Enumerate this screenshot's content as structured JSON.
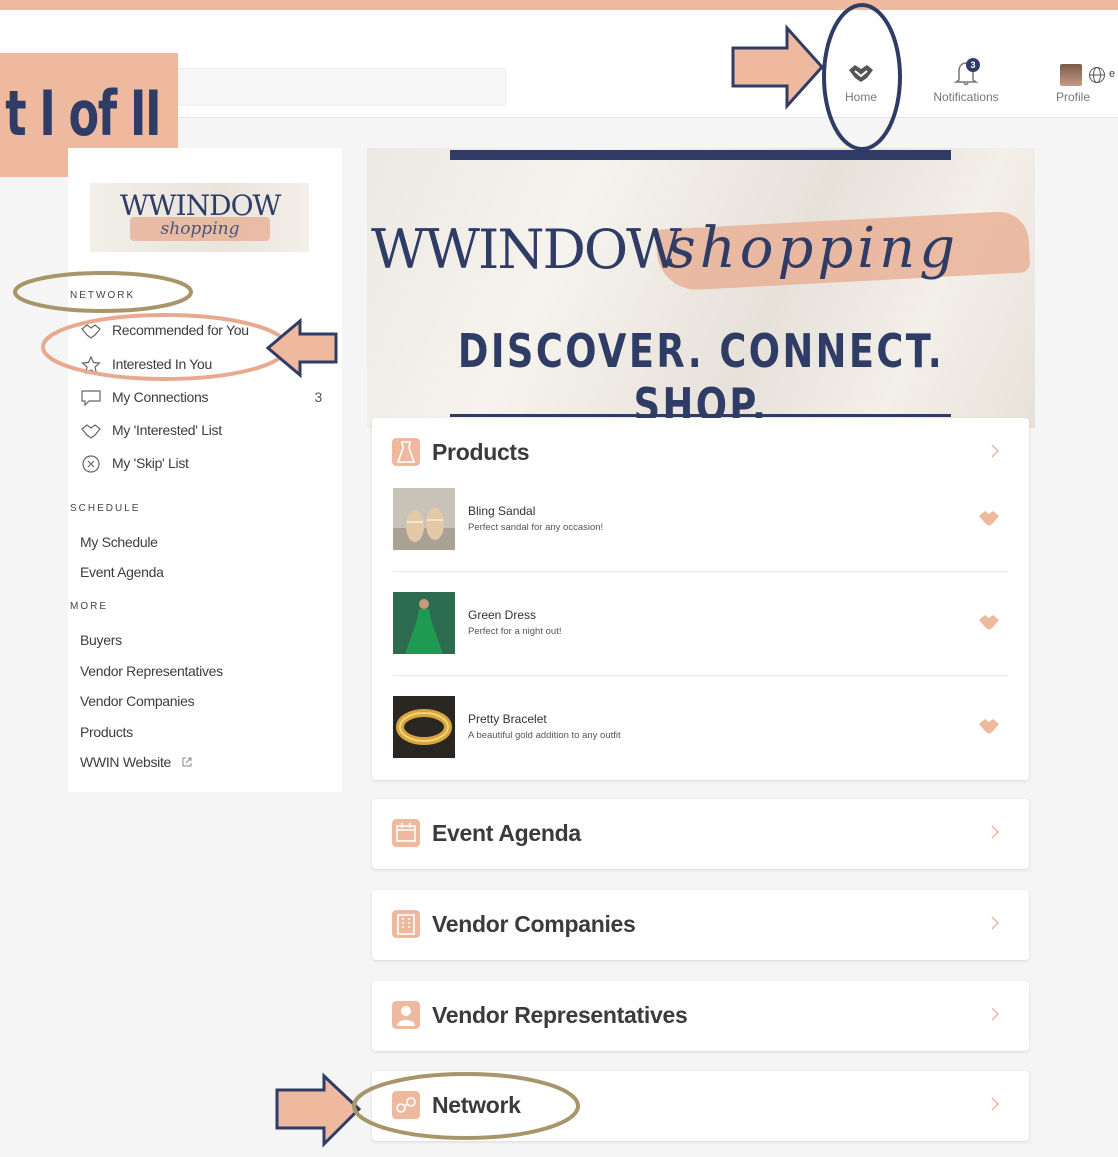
{
  "banner": {
    "title": "t I of II"
  },
  "header": {
    "nav": [
      {
        "label": "Home",
        "icon": "handshake-icon"
      },
      {
        "label": "Notifications",
        "icon": "bell-icon",
        "badge": "3"
      },
      {
        "label": "Profile",
        "icon": "avatar"
      }
    ],
    "lang_fragment": "e"
  },
  "sidebar": {
    "logo": {
      "brand": "WWINDOW",
      "script": "shopping"
    },
    "network": {
      "heading": "NETWORK",
      "items": [
        {
          "label": "Recommended for You",
          "icon": "handshake-icon"
        },
        {
          "label": "Interested In You",
          "icon": "star-icon"
        },
        {
          "label": "My Connections",
          "icon": "chat-icon",
          "count": "3"
        },
        {
          "label": "My 'Interested' List",
          "icon": "handshake-icon"
        },
        {
          "label": "My 'Skip' List",
          "icon": "close-circle-icon"
        }
      ]
    },
    "schedule": {
      "heading": "SCHEDULE",
      "items": [
        "My Schedule",
        "Event Agenda"
      ]
    },
    "more": {
      "heading": "MORE",
      "items": [
        "Buyers",
        "Vendor Representatives",
        "Vendor Companies",
        "Products",
        "WWIN Website"
      ]
    }
  },
  "hero": {
    "brand": "WWINDOW",
    "script": "shopping",
    "tagline": "DISCOVER. CONNECT. SHOP."
  },
  "cards": {
    "products": {
      "title": "Products",
      "items": [
        {
          "name": "Bling Sandal",
          "description": "Perfect sandal for any occasion!"
        },
        {
          "name": "Green Dress",
          "description": "Perfect for a night out!"
        },
        {
          "name": "Pretty Bracelet",
          "description": "A beautiful gold addition to any outfit"
        }
      ]
    },
    "event_agenda": {
      "title": "Event Agenda"
    },
    "vendor_companies": {
      "title": "Vendor Companies"
    },
    "vendor_representatives": {
      "title": "Vendor Representatives"
    },
    "network": {
      "title": "Network"
    }
  },
  "colors": {
    "accent": "#efb99f",
    "navy": "#2f3d66",
    "annotation_gold": "#a8956a",
    "annotation_peach": "#e8a98e"
  }
}
